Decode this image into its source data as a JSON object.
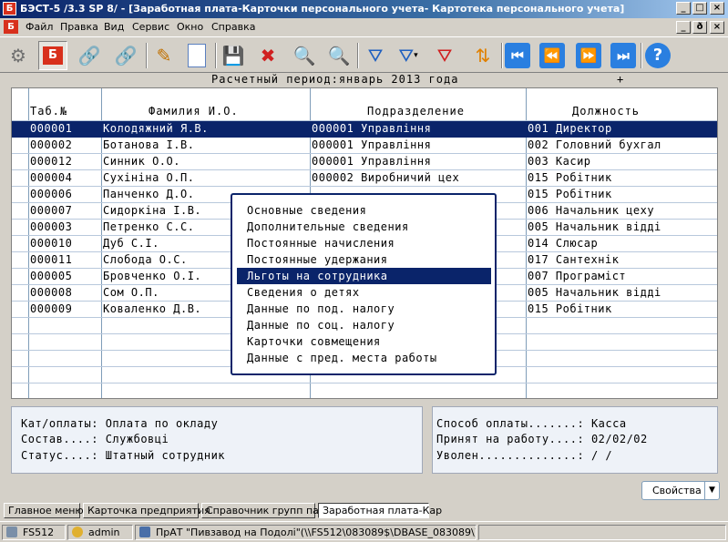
{
  "window": {
    "title": "БЭСТ-5 /3.3 SP 8/ - [Заработная плата-Карточки персонального учета- Картотека персонального учета]",
    "app_icon": "Б",
    "controls": [
      "_",
      "□",
      "×"
    ]
  },
  "menu": {
    "icon": "Б",
    "items": [
      "Файл",
      "Правка",
      "Вид",
      "Сервис",
      "Окно",
      "Справка"
    ],
    "mdi_controls": [
      "_",
      "ð",
      "×"
    ]
  },
  "toolbar": {
    "buttons": [
      {
        "name": "network-icon",
        "glyph": "⚙"
      },
      {
        "name": "card-file-icon",
        "glyph": "Б"
      },
      {
        "name": "link-icon",
        "glyph": "🔗"
      },
      {
        "name": "link-edit-icon",
        "glyph": "🔗"
      },
      {
        "name": "edit-icon",
        "glyph": "✎"
      },
      {
        "name": "new-document-icon",
        "glyph": ""
      },
      {
        "name": "save-icon",
        "glyph": "💾"
      },
      {
        "name": "delete-icon",
        "glyph": "✖"
      },
      {
        "name": "find-icon",
        "glyph": "🔍"
      },
      {
        "name": "find-next-icon",
        "glyph": "🔍"
      },
      {
        "name": "filter-icon",
        "glyph": "⛛"
      },
      {
        "name": "filter-dropdown-icon",
        "glyph": "⛛"
      },
      {
        "name": "clear-filter-icon",
        "glyph": "⛛"
      },
      {
        "name": "sort-icon",
        "glyph": "⇅"
      },
      {
        "name": "first-record-icon",
        "glyph": "⏮"
      },
      {
        "name": "prev-record-icon",
        "glyph": "⏪"
      },
      {
        "name": "next-record-icon",
        "glyph": "⏩"
      },
      {
        "name": "last-record-icon",
        "glyph": "⏭"
      },
      {
        "name": "help-icon",
        "glyph": "?"
      }
    ]
  },
  "period": {
    "label": "Расчетный период:январь 2013 года",
    "plus": "+"
  },
  "table": {
    "columns": [
      "Таб.№",
      "Фамилия И.О.",
      "Подразделение",
      "Должность"
    ],
    "rows": [
      [
        "000001",
        "Колодяжний Я.В.",
        "000001 Управління",
        "001 Директор"
      ],
      [
        "000002",
        "Ботанова І.В.",
        "000001 Управління",
        "002 Головний бухгал"
      ],
      [
        "000012",
        "Синник О.О.",
        "000001 Управління",
        "003 Касир"
      ],
      [
        "000004",
        "Сухініна О.П.",
        "000002 Виробничий цех",
        "015 Робітник"
      ],
      [
        "000006",
        "Панченко Д.О.",
        "",
        "015 Робітник"
      ],
      [
        "000007",
        "Сидоркіна І.В.",
        "",
        "006 Начальник цеху"
      ],
      [
        "000003",
        "Петренко С.С.",
        "",
        "005 Начальник відді"
      ],
      [
        "000010",
        "Дуб С.І.",
        "",
        "014 Слюсар"
      ],
      [
        "000011",
        "Слобода О.С.",
        "",
        "017 Сантехнік"
      ],
      [
        "000005",
        "Бровченко О.І.",
        "",
        "007 Програміст"
      ],
      [
        "000008",
        "Сом О.П.",
        "",
        "005 Начальник відді"
      ],
      [
        "000009",
        "Коваленко Д.В.",
        "",
        "015 Робітник"
      ]
    ],
    "selected_row": 0
  },
  "popup": {
    "items": [
      "Основные сведения",
      "Дополнительные сведения",
      "Постоянные начисления",
      "Постоянные удержания",
      "Льготы на сотрудника",
      "Сведения о детях",
      "Данные по под. налогу",
      "Данные по соц. налогу",
      "Карточки совмещения",
      "Данные с пред. места работы"
    ],
    "selected": 4
  },
  "info_left": {
    "lines": [
      "Кат/оплаты: Оплата по окладу",
      "Состав....: Службовці",
      "Статус....: Штатный сотрудник"
    ]
  },
  "info_right": {
    "lines": [
      "Способ оплаты.......: Касса",
      "Принят на работу....: 02/02/02",
      "Уволен..............:   /  /"
    ]
  },
  "properties_button": {
    "label": "Свойства",
    "arrow": "▼"
  },
  "tabs": [
    "Главное меню",
    "Карточка предприятия",
    "Справочник групп пар",
    "Заработная плата-Кар"
  ],
  "active_tab": 3,
  "statusbar": {
    "server": "FS512",
    "user": "admin",
    "company": "ПрАТ \"Пивзавод на Подолі\"(\\\\FS512\\083089$\\DBASE_083089\\)"
  },
  "colors": {
    "selection": "#0a246a",
    "title_gradient_start": "#0a246a",
    "popup_border": "#0a246a",
    "grid_line": "#7f9db9"
  }
}
